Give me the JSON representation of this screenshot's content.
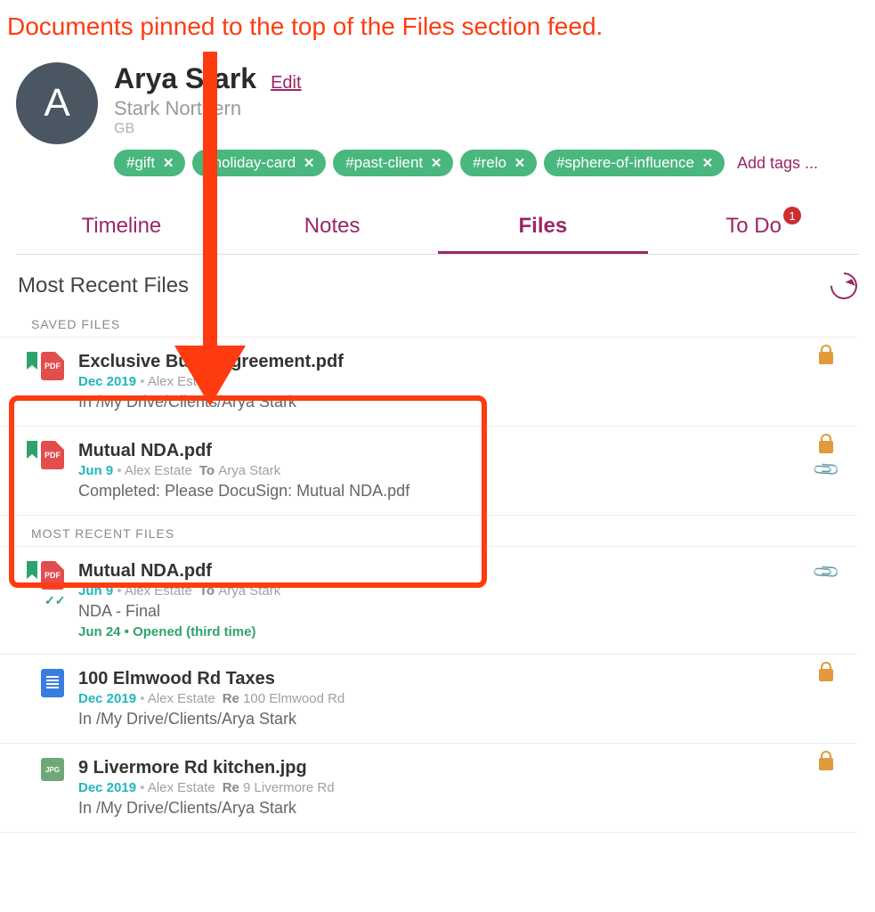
{
  "annotation": "Documents pinned to the top of the Files section feed.",
  "profile": {
    "avatar_letter": "A",
    "name": "Arya Stark",
    "edit": "Edit",
    "company": "Stark Northern",
    "country": "GB"
  },
  "tags": {
    "items": [
      "#gift",
      "#holiday-card",
      "#past-client",
      "#relo",
      "#sphere-of-influence"
    ],
    "add": "Add tags ..."
  },
  "tabs": {
    "timeline": "Timeline",
    "notes": "Notes",
    "files": "Files",
    "todo": "To Do",
    "todo_badge": "1"
  },
  "section": {
    "title": "Most Recent Files",
    "saved_label": "SAVED FILES",
    "recent_label": "MOST RECENT FILES"
  },
  "saved_files": [
    {
      "name": "Exclusive Buyer agreement.pdf",
      "date": "Dec 2019",
      "author": "Alex Estate",
      "desc": "In /My Drive/Clients/Arya Stark",
      "icon": "pdf",
      "bookmark": true,
      "locked": true
    },
    {
      "name": "Mutual NDA.pdf",
      "date": "Jun 9",
      "author": "Alex Estate",
      "to_label": "To",
      "to": "Arya Stark",
      "desc": "Completed: Please DocuSign: Mutual NDA.pdf",
      "icon": "pdf",
      "bookmark": true,
      "locked": true,
      "attachment": true
    }
  ],
  "recent_files": [
    {
      "name": "Mutual NDA.pdf",
      "date": "Jun 9",
      "author": "Alex Estate",
      "to_label": "To",
      "to": "Arya Stark",
      "desc": "NDA - Final",
      "status": "Jun 24 • Opened (third time)",
      "icon": "pdf",
      "bookmark": true,
      "checkmark": true,
      "attachment": true
    },
    {
      "name": "100 Elmwood Rd Taxes",
      "date": "Dec 2019",
      "author": "Alex Estate",
      "re_label": "Re",
      "re": "100 Elmwood Rd",
      "desc": "In /My Drive/Clients/Arya Stark",
      "icon": "doc",
      "locked": true
    },
    {
      "name": "9 Livermore Rd kitchen.jpg",
      "date": "Dec 2019",
      "author": "Alex Estate",
      "re_label": "Re",
      "re": "9 Livermore Rd",
      "desc": "In /My Drive/Clients/Arya Stark",
      "icon": "jpg",
      "locked": true
    }
  ]
}
